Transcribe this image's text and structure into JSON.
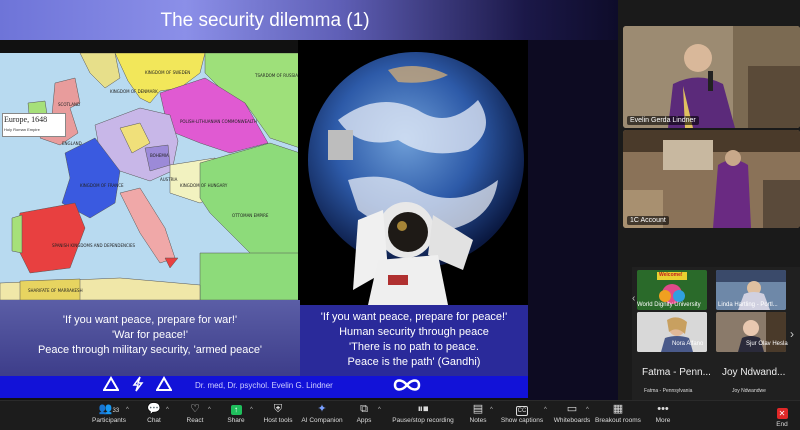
{
  "slide": {
    "title": "The security dilemma (1)",
    "map": {
      "legend_title": "Europe, 1648",
      "legend_item": "Holy Roman Empire",
      "labels": [
        "KINGDOM OF SWEDEN",
        "TSARDOM OF RUSSIA",
        "SCOTLAND",
        "ENGLAND",
        "KINGDOM OF DENMARK",
        "POLISH-LITHUANIAN COMMONWEALTH",
        "KINGDOM OF FRANCE",
        "BOHEMIA",
        "AUSTRIA",
        "KINGDOM OF HUNGARY",
        "OTTOMAN EMPIRE",
        "SPANISH KINGDOMS AND DEPENDENCIES",
        "SHARIFATE OF MARRAKESH"
      ]
    },
    "quotes_left": [
      "'If you want peace, prepare for war!'",
      "'War for peace!'",
      "Peace through military security, 'armed peace'"
    ],
    "quotes_right": [
      "'If you want peace, prepare for peace!'",
      "Human security through peace",
      "'There is no path to peace.",
      "Peace is the path' (Gandhi)"
    ],
    "footer": "Dr. med, Dr. psychol. Evelin G. Lindner"
  },
  "videos": [
    {
      "name": "Evelin Gerda Lindner"
    },
    {
      "name": "1C Account"
    }
  ],
  "gallery": {
    "tiles": [
      {
        "label": "World Dignity University",
        "banner": "Welcome!"
      },
      {
        "label": "Linda Hartling - Portl..."
      },
      {
        "label": "Nora Alfano"
      },
      {
        "label": "Sjur Olav Hesla"
      }
    ],
    "names": [
      "Fatma - Penn...",
      "Joy Ndwand..."
    ],
    "subnames": [
      "Fatma - Pennsylvania",
      "Joy Ndwandwe"
    ]
  },
  "toolbar": {
    "participants_count": "33",
    "items": [
      {
        "label": "Participants",
        "icon": "people-icon"
      },
      {
        "label": "Chat",
        "icon": "chat-icon"
      },
      {
        "label": "React",
        "icon": "heart-icon"
      },
      {
        "label": "Share",
        "icon": "share-icon"
      },
      {
        "label": "Host tools",
        "icon": "shield-icon"
      },
      {
        "label": "AI Companion",
        "icon": "sparkle-icon"
      },
      {
        "label": "Apps",
        "icon": "apps-icon"
      },
      {
        "label": "Pause/stop recording",
        "icon": "pause-stop-icon"
      },
      {
        "label": "Notes",
        "icon": "notes-icon"
      },
      {
        "label": "Show captions",
        "icon": "cc-icon"
      },
      {
        "label": "Whiteboards",
        "icon": "whiteboard-icon"
      },
      {
        "label": "Breakout rooms",
        "icon": "grid-icon"
      },
      {
        "label": "More",
        "icon": "more-icon"
      },
      {
        "label": "End",
        "icon": "close-icon"
      }
    ]
  },
  "colors": {
    "share_green": "#1fbf5c",
    "footer_blue": "#1212d8",
    "end_red": "#e02828"
  }
}
